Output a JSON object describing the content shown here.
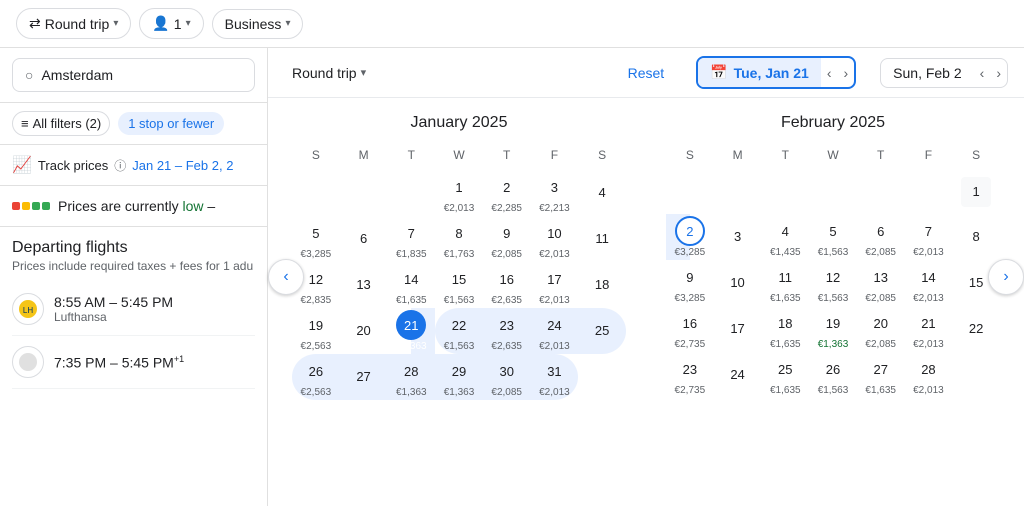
{
  "topbar": {
    "roundtrip_label": "Round trip",
    "passengers_label": "1",
    "class_label": "Business"
  },
  "left": {
    "search_placeholder": "Amsterdam",
    "filters_label": "All filters (2)",
    "stop_label": "1 stop or fewer",
    "track_label": "Track prices",
    "track_dates": "Jan 21 – Feb 2, 2",
    "prices_low_1": "Prices are currently low",
    "prices_low_highlight": "low",
    "departing_title": "Departing flights",
    "departing_subtitle": "Prices include required taxes + fees for 1 adu",
    "flights": [
      {
        "time": "8:55 AM – 5:45 PM",
        "airline": "Lufthansa"
      },
      {
        "time": "7:35 PM – 5:45 PM",
        "airline": ""
      }
    ]
  },
  "calendar_header": {
    "roundtrip_label": "Round trip",
    "reset_label": "Reset",
    "date_start": "Tue, Jan 21",
    "date_end": "Sun, Feb 2"
  },
  "january": {
    "title": "January 2025",
    "days_header": [
      "S",
      "M",
      "T",
      "W",
      "T",
      "F",
      "S"
    ],
    "weeks": [
      [
        {
          "num": "",
          "price": "",
          "state": "empty"
        },
        {
          "num": "",
          "price": "",
          "state": "empty"
        },
        {
          "num": "",
          "price": "",
          "state": "empty"
        },
        {
          "num": "1",
          "price": "€2,013",
          "state": ""
        },
        {
          "num": "2",
          "price": "€2,285",
          "state": ""
        },
        {
          "num": "3",
          "price": "€2,213",
          "state": ""
        },
        {
          "num": "4",
          "price": "",
          "state": ""
        }
      ],
      [
        {
          "num": "5",
          "price": "€3,285",
          "state": ""
        },
        {
          "num": "6",
          "price": "",
          "state": ""
        },
        {
          "num": "7",
          "price": "€1,835",
          "state": ""
        },
        {
          "num": "8",
          "price": "€1,763",
          "state": ""
        },
        {
          "num": "9",
          "price": "€2,085",
          "state": ""
        },
        {
          "num": "10",
          "price": "€2,013",
          "state": ""
        },
        {
          "num": "11",
          "price": "",
          "state": ""
        }
      ],
      [
        {
          "num": "12",
          "price": "€2,835",
          "state": ""
        },
        {
          "num": "13",
          "price": "",
          "state": ""
        },
        {
          "num": "14",
          "price": "€1,635",
          "state": ""
        },
        {
          "num": "15",
          "price": "€1,563",
          "state": ""
        },
        {
          "num": "16",
          "price": "€2,635",
          "state": ""
        },
        {
          "num": "17",
          "price": "€2,013",
          "state": ""
        },
        {
          "num": "18",
          "price": "",
          "state": ""
        }
      ],
      [
        {
          "num": "19",
          "price": "€2,563",
          "state": ""
        },
        {
          "num": "20",
          "price": "",
          "state": ""
        },
        {
          "num": "21",
          "price": "€1,363",
          "state": "selected-start"
        },
        {
          "num": "22",
          "price": "€1,563",
          "state": "in-range"
        },
        {
          "num": "23",
          "price": "€2,635",
          "state": "in-range"
        },
        {
          "num": "24",
          "price": "€2,013",
          "state": "in-range"
        },
        {
          "num": "25",
          "price": "",
          "state": "in-range"
        }
      ],
      [
        {
          "num": "26",
          "price": "€2,563",
          "state": "in-range"
        },
        {
          "num": "27",
          "price": "",
          "state": "in-range"
        },
        {
          "num": "28",
          "price": "€1,363",
          "state": "in-range"
        },
        {
          "num": "29",
          "price": "€1,363",
          "state": "in-range"
        },
        {
          "num": "30",
          "price": "€2,085",
          "state": "in-range"
        },
        {
          "num": "31",
          "price": "€2,013",
          "state": "in-range"
        },
        {
          "num": "",
          "price": "",
          "state": "empty"
        }
      ]
    ]
  },
  "february": {
    "title": "February 2025",
    "days_header": [
      "S",
      "M",
      "T",
      "W",
      "T",
      "F",
      "S"
    ],
    "weeks": [
      [
        {
          "num": "",
          "price": "",
          "state": "empty"
        },
        {
          "num": "",
          "price": "",
          "state": "empty"
        },
        {
          "num": "",
          "price": "",
          "state": "empty"
        },
        {
          "num": "",
          "price": "",
          "state": "empty"
        },
        {
          "num": "",
          "price": "",
          "state": "empty"
        },
        {
          "num": "",
          "price": "",
          "state": "empty"
        },
        {
          "num": "1",
          "price": "",
          "state": "feb1"
        }
      ],
      [
        {
          "num": "2",
          "price": "€3,285",
          "state": "selected-end"
        },
        {
          "num": "3",
          "price": "",
          "state": ""
        },
        {
          "num": "4",
          "price": "€1,435",
          "state": ""
        },
        {
          "num": "5",
          "price": "€1,563",
          "state": ""
        },
        {
          "num": "6",
          "price": "€2,085",
          "state": ""
        },
        {
          "num": "7",
          "price": "€2,013",
          "state": ""
        },
        {
          "num": "8",
          "price": "",
          "state": ""
        }
      ],
      [
        {
          "num": "9",
          "price": "€3,285",
          "state": ""
        },
        {
          "num": "10",
          "price": "",
          "state": ""
        },
        {
          "num": "11",
          "price": "€1,635",
          "state": ""
        },
        {
          "num": "12",
          "price": "€1,563",
          "state": ""
        },
        {
          "num": "13",
          "price": "€2,085",
          "state": ""
        },
        {
          "num": "14",
          "price": "€2,013",
          "state": ""
        },
        {
          "num": "15",
          "price": "",
          "state": ""
        }
      ],
      [
        {
          "num": "16",
          "price": "€2,735",
          "state": ""
        },
        {
          "num": "17",
          "price": "",
          "state": ""
        },
        {
          "num": "18",
          "price": "€1,635",
          "state": ""
        },
        {
          "num": "19",
          "price": "€1,363",
          "state": "green"
        },
        {
          "num": "20",
          "price": "€2,085",
          "state": ""
        },
        {
          "num": "21",
          "price": "€2,013",
          "state": ""
        },
        {
          "num": "22",
          "price": "",
          "state": ""
        }
      ],
      [
        {
          "num": "23",
          "price": "€2,735",
          "state": ""
        },
        {
          "num": "24",
          "price": "",
          "state": ""
        },
        {
          "num": "25",
          "price": "€1,635",
          "state": ""
        },
        {
          "num": "26",
          "price": "€1,563",
          "state": ""
        },
        {
          "num": "27",
          "price": "€1,635",
          "state": ""
        },
        {
          "num": "28",
          "price": "€2,013",
          "state": ""
        },
        {
          "num": "",
          "price": "",
          "state": "empty"
        }
      ]
    ]
  }
}
